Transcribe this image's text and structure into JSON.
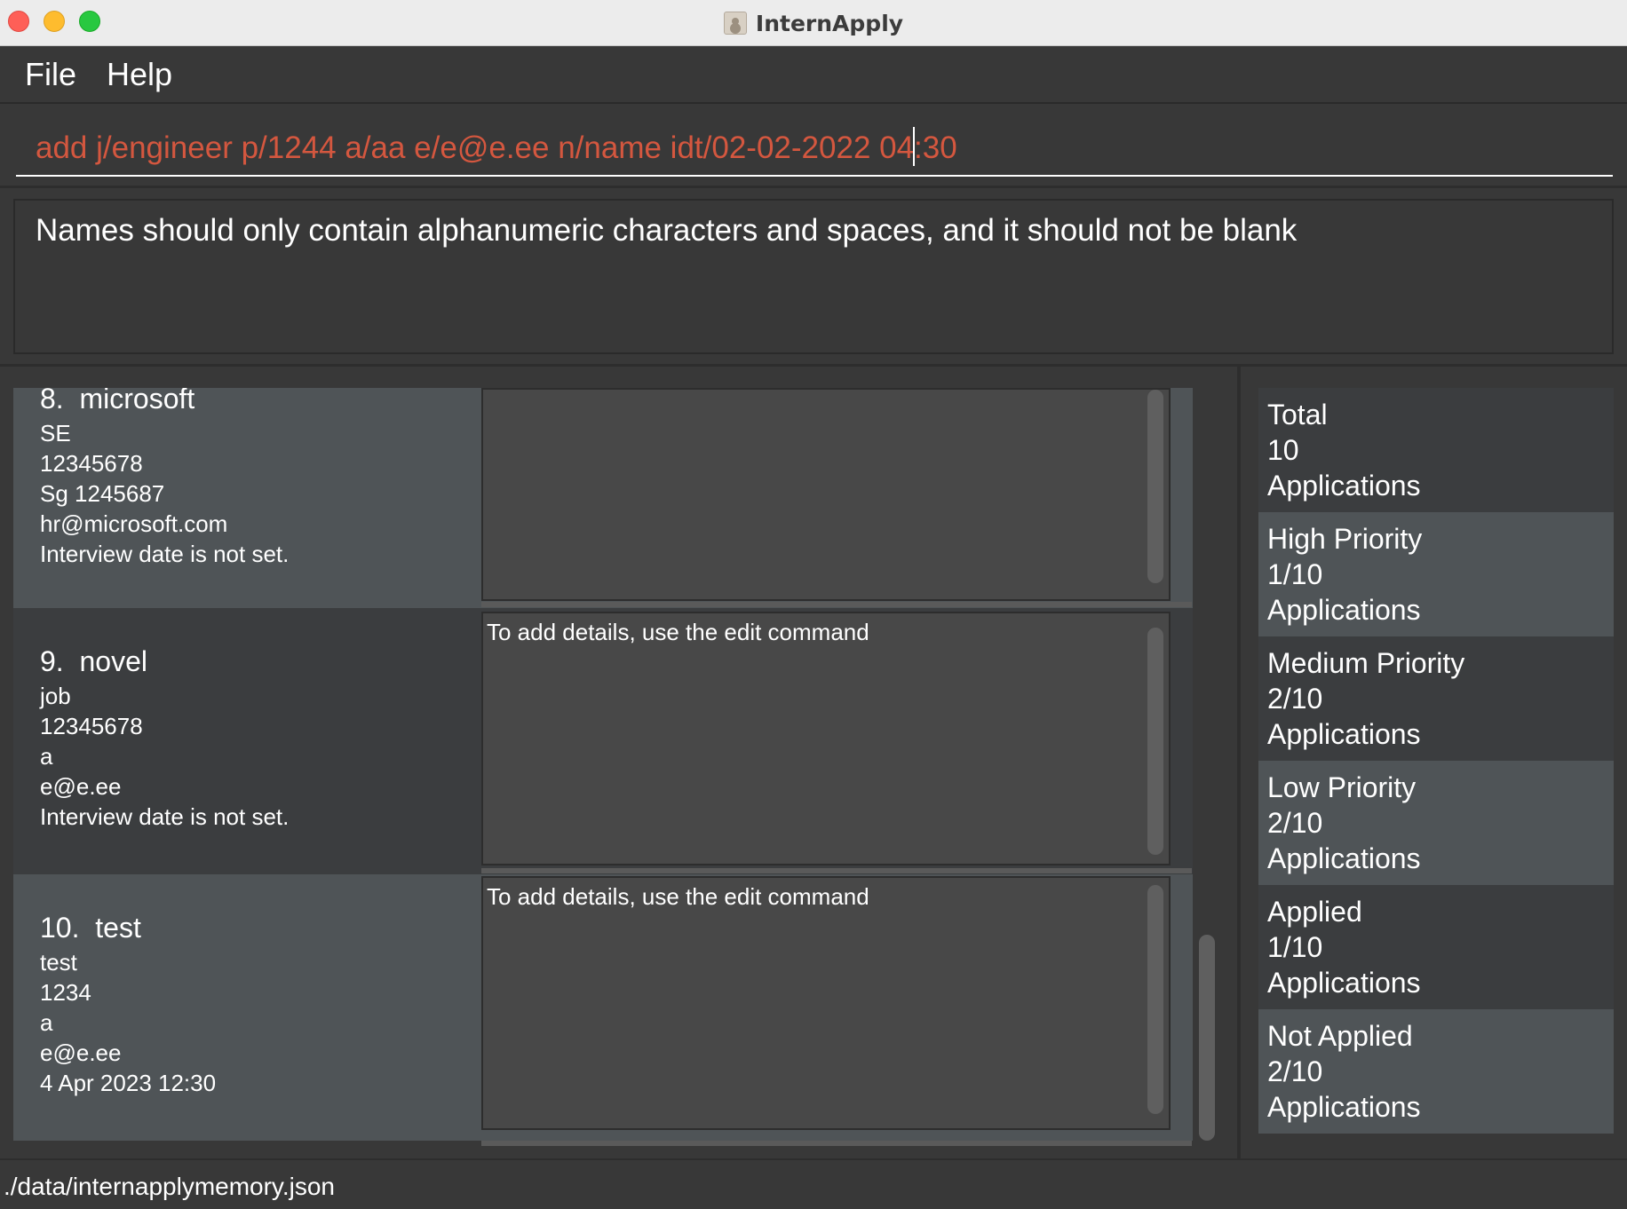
{
  "window": {
    "title": "InternApply"
  },
  "menu": {
    "file": "File",
    "help": "Help"
  },
  "command": {
    "value": "add j/engineer p/1244 a/aa e/e@e.ee n/name idt/02-02-2022 04:30"
  },
  "result": {
    "message": "Names should only contain alphanumeric characters and spaces, and it should not be blank"
  },
  "applications": [
    {
      "index": "8.",
      "company": "microsoft",
      "role": "SE",
      "phone": "12345678",
      "address": "Sg 1245687",
      "email": "hr@microsoft.com",
      "interview": "Interview date is not set.",
      "details": ""
    },
    {
      "index": "9.",
      "company": "novel",
      "role": "job",
      "phone": "12345678",
      "address": "a",
      "email": "e@e.ee",
      "interview": "Interview date is not set.",
      "details": "To add details, use the edit command"
    },
    {
      "index": "10.",
      "company": "test",
      "role": "test",
      "phone": "1234",
      "address": "a",
      "email": "e@e.ee",
      "interview": "4 Apr 2023 12:30",
      "details": "To add details, use the edit command"
    }
  ],
  "stats": [
    {
      "label": "Total",
      "value": "10",
      "unit": "Applications"
    },
    {
      "label": "High Priority",
      "value": "1/10",
      "unit": "Applications"
    },
    {
      "label": "Medium Priority",
      "value": "2/10",
      "unit": "Applications"
    },
    {
      "label": "Low Priority",
      "value": "2/10",
      "unit": "Applications"
    },
    {
      "label": "Applied",
      "value": "1/10",
      "unit": "Applications"
    },
    {
      "label": "Not Applied",
      "value": "2/10",
      "unit": "Applications"
    }
  ],
  "status": {
    "path": "./data/internapplymemory.json"
  },
  "colors": {
    "command_text": "#d4573f",
    "background": "#383838",
    "card_light": "#4f5457",
    "card_dark": "#3b3d3f"
  }
}
